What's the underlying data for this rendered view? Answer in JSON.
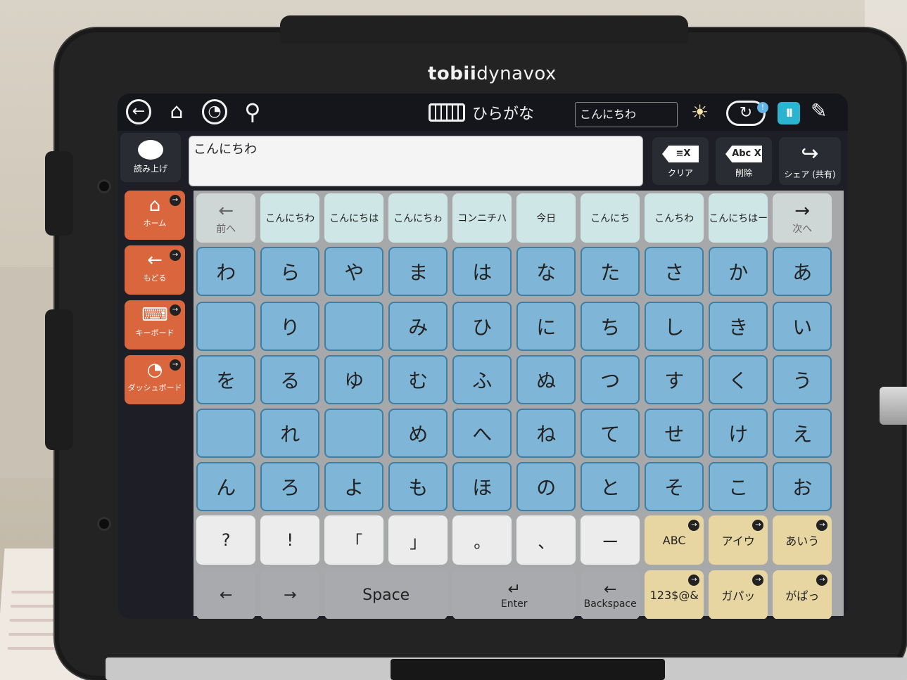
{
  "device": {
    "brand_bold": "tobii",
    "brand_rest": "dynavox"
  },
  "topbar": {
    "back_icon": "back-icon",
    "home_icon": "home-icon",
    "dashboard_icon": "dashboard-icon",
    "search_icon": "search-icon",
    "keyboard_icon": "keyboard-icon",
    "page_title": "ひらがな",
    "field_text": "こんにちわ",
    "sync_badge": "!",
    "pause_label": "II"
  },
  "message": {
    "speak_label": "読み上げ",
    "text": "こんにちわ",
    "clear_glyph": "≡X",
    "clear_label": "クリア",
    "delete_glyph": "Abc X",
    "delete_label": "削除",
    "share_label": "シェア (共有)"
  },
  "nav": [
    {
      "label": "ホーム",
      "icon": "home-icon"
    },
    {
      "label": "もどる",
      "icon": "back-icon"
    },
    {
      "label": "キーボード",
      "icon": "keyboard-icon"
    },
    {
      "label": "ダッシュボード",
      "icon": "dashboard-icon"
    }
  ],
  "predictions": {
    "prev_arrow": "←",
    "prev_label": "前へ",
    "items": [
      "こんにちわ",
      "こんにちは",
      "こんにちゎ",
      "コンニチハ",
      "今日",
      "こんにち",
      "こんちわ",
      "こんにちはー"
    ],
    "next_arrow": "→",
    "next_label": "次へ"
  },
  "kana_rows": [
    [
      "わ",
      "ら",
      "や",
      "ま",
      "は",
      "な",
      "た",
      "さ",
      "か",
      "あ"
    ],
    [
      "",
      "り",
      "",
      "み",
      "ひ",
      "に",
      "ち",
      "し",
      "き",
      "い"
    ],
    [
      "を",
      "る",
      "ゆ",
      "む",
      "ふ",
      "ぬ",
      "つ",
      "す",
      "く",
      "う"
    ],
    [
      "",
      "れ",
      "",
      "め",
      "へ",
      "ね",
      "て",
      "せ",
      "け",
      "え"
    ],
    [
      "ん",
      "ろ",
      "よ",
      "も",
      "ほ",
      "の",
      "と",
      "そ",
      "こ",
      "お"
    ]
  ],
  "punctuation": [
    "?",
    "!",
    "「",
    "」",
    "。",
    "、",
    "ー"
  ],
  "modes_row1": [
    "ABC",
    "アイウ",
    "あいう"
  ],
  "controls": {
    "left": "←",
    "right": "→",
    "space": "Space",
    "enter_arrow": "↵",
    "enter": "Enter",
    "backspace_arrow": "←",
    "backspace": "Backspace"
  },
  "modes_row2": [
    "123$@&",
    "ガパッ",
    "がぱっ"
  ]
}
